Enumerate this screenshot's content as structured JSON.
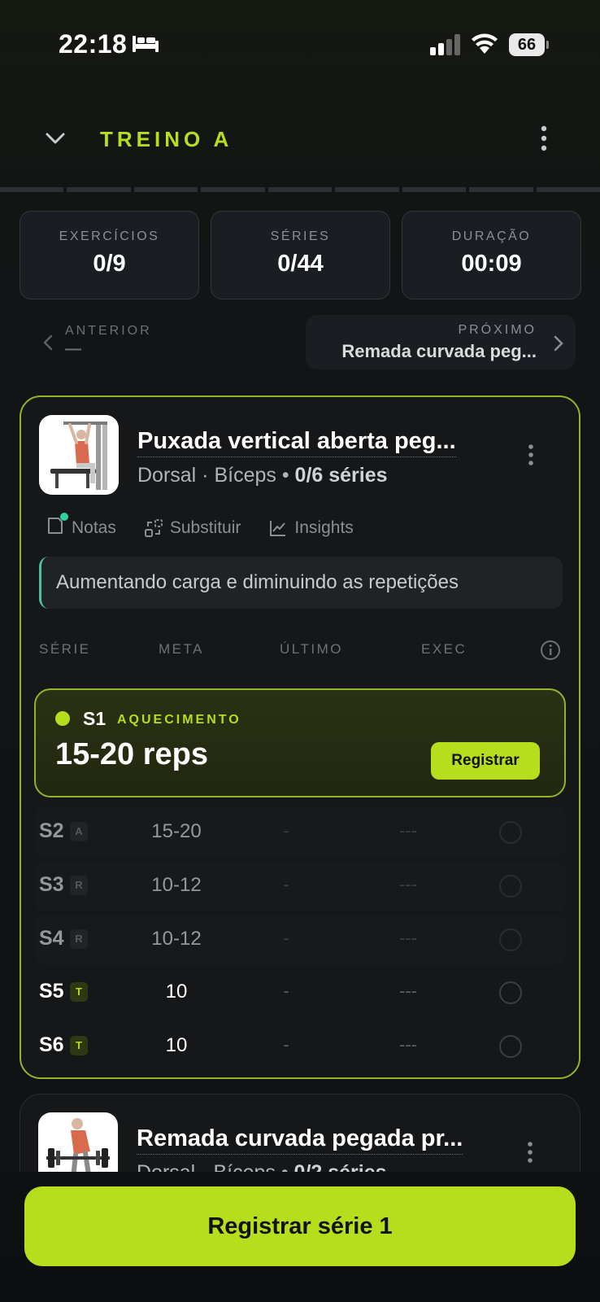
{
  "status_bar": {
    "time": "22:18",
    "battery": "66"
  },
  "header": {
    "title": "TREINO A"
  },
  "stats": [
    {
      "label": "EXERCÍCIOS",
      "value": "0/9"
    },
    {
      "label": "SÉRIES",
      "value": "0/44"
    },
    {
      "label": "DURAÇÃO",
      "value": "00:09"
    }
  ],
  "nav": {
    "prev_label": "ANTERIOR",
    "prev_value": "—",
    "next_label": "PRÓXIMO",
    "next_value": "Remada curvada peg..."
  },
  "exercise": {
    "name": "Puxada vertical aberta peg...",
    "muscles": "Dorsal · Bíceps",
    "sets_progress": "0/6 séries",
    "actions": {
      "notes": "Notas",
      "substitute": "Substituir",
      "insights": "Insights"
    },
    "note": "Aumentando carga e diminuindo as repetições",
    "columns": {
      "set": "SÉRIE",
      "goal": "META",
      "last": "ÚLTIMO",
      "exec": "EXEC"
    },
    "active_set": {
      "label": "S1",
      "type": "AQUECIMENTO",
      "reps": "15-20 reps",
      "button": "Registrar"
    },
    "sets": [
      {
        "id": "S2",
        "badge": "A",
        "goal": "15-20",
        "last": "-",
        "exec": "---"
      },
      {
        "id": "S3",
        "badge": "R",
        "goal": "10-12",
        "last": "-",
        "exec": "---"
      },
      {
        "id": "S4",
        "badge": "R",
        "goal": "10-12",
        "last": "-",
        "exec": "---"
      },
      {
        "id": "S5",
        "badge": "T",
        "goal": "10",
        "last": "-",
        "exec": "---"
      },
      {
        "id": "S6",
        "badge": "T",
        "goal": "10",
        "last": "-",
        "exec": "---"
      }
    ]
  },
  "next_exercise": {
    "name": "Remada curvada pegada pr...",
    "muscles": "Dorsal · Bíceps",
    "sets_progress": "0/2 séries"
  },
  "cta": {
    "label": "Registrar série 1"
  },
  "colors": {
    "accent": "#b6de1c",
    "note_accent": "#4cc59b",
    "background": "#121416"
  }
}
